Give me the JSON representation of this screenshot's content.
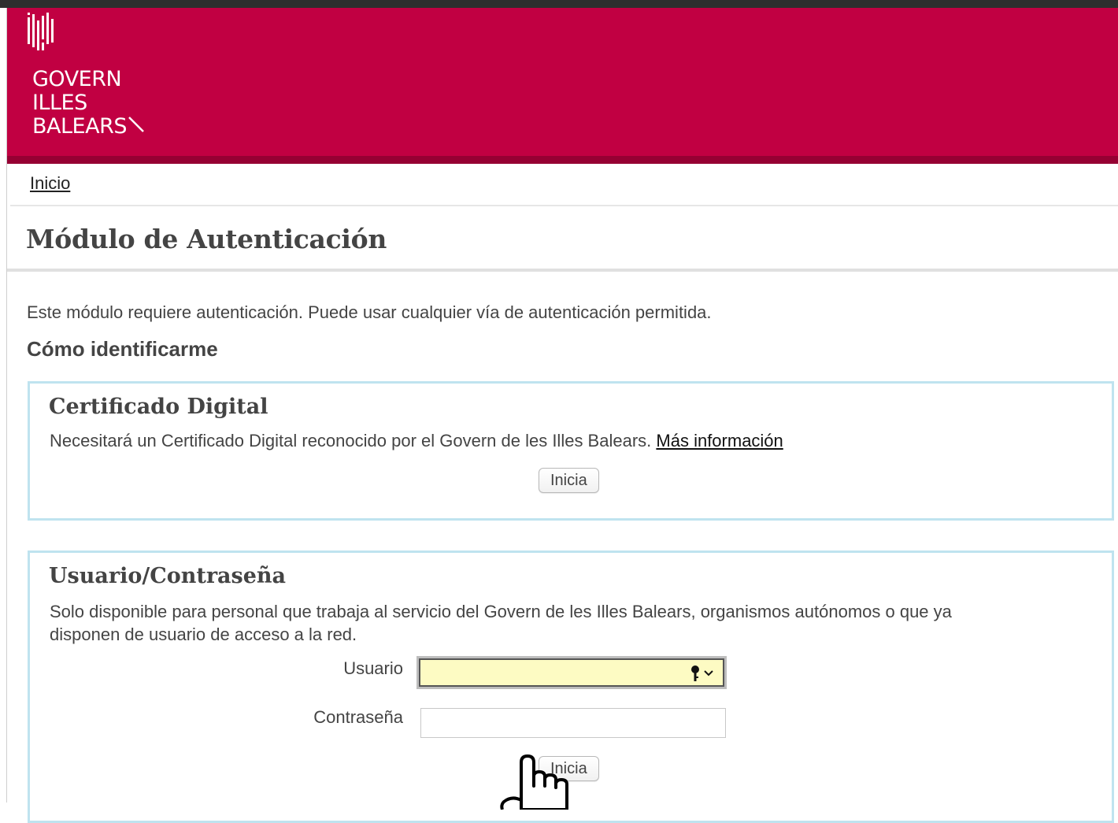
{
  "header": {
    "logo_lines": [
      "GOVERN",
      "ILLES",
      "BALEARS"
    ],
    "brand_color": "#c10042"
  },
  "breadcrumb": {
    "home_label": "Inicio"
  },
  "page_title": "Módulo de Autenticación",
  "intro_text": "Este módulo requiere autenticación. Puede usar cualquier vía de autenticación permitida.",
  "how_heading": "Cómo identificarme",
  "cert_panel": {
    "title": "Certificado Digital",
    "description": "Necesitará un Certificado Digital reconocido por el Govern de les Illes Balears.",
    "more_info_link": "Más información",
    "button_label": "Inicia"
  },
  "user_panel": {
    "title": "Usuario/Contraseña",
    "description_line1": "Solo disponible para personal que trabaja al servicio del Govern de les Illes Balears, organismos autónomos o que ya",
    "description_line2": "disponen de usuario de acceso a la red.",
    "username_label": "Usuario",
    "username_value": "",
    "password_label": "Contraseña",
    "password_value": "",
    "button_label": "Inicia"
  },
  "icons": {
    "logo": "govern-logo-icon",
    "password_key": "key-icon",
    "dropdown": "chevron-down-icon",
    "cursor": "hand-pointer-icon"
  }
}
